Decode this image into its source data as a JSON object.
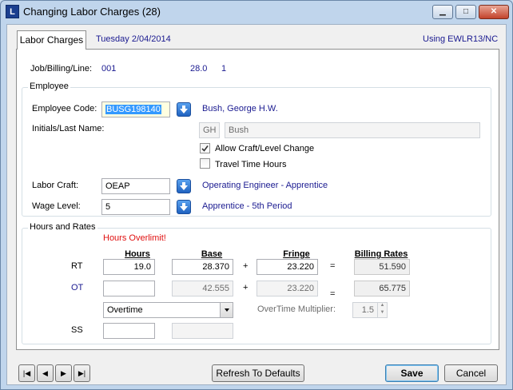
{
  "window": {
    "title": "Changing Labor Charges  (28)",
    "app_icon": "L",
    "minimize": "▁",
    "maximize": "□",
    "close": "✕"
  },
  "tab": {
    "label": "Labor Charges",
    "date": "Tuesday  2/04/2014",
    "using": "Using EWLR13/NC"
  },
  "job": {
    "label": "Job/Billing/Line:",
    "job": "001",
    "billing": "28.0",
    "line": "1"
  },
  "employee": {
    "group_label": "Employee",
    "code_label": "Employee Code:",
    "code_value": "BUSG198140",
    "name": "Bush, George H.W.",
    "initials_label": "Initials/Last Name:",
    "initials": "GH",
    "last_name": "Bush",
    "allow_craft_label": "Allow Craft/Level Change",
    "allow_craft_checked": true,
    "travel_label": "Travel Time Hours",
    "travel_checked": false,
    "craft_label": "Labor Craft:",
    "craft_value": "OEAP",
    "craft_desc": "Operating Engineer - Apprentice",
    "wage_label": "Wage Level:",
    "wage_value": "5",
    "wage_desc": "Apprentice - 5th Period"
  },
  "hours": {
    "group_label": "Hours and Rates",
    "warning": "Hours Overlimit!",
    "col_hours": "Hours",
    "col_base": "Base",
    "col_fringe": "Fringe",
    "col_billing": "Billing Rates",
    "plus": "+",
    "equals": "=",
    "rt_label": "RT",
    "rt_hours": "19.0",
    "rt_base": "28.370",
    "rt_fringe": "23.220",
    "rt_billing": "51.590",
    "ot_label": "OT",
    "ot_hours": "",
    "ot_base": "42.555",
    "ot_fringe": "23.220",
    "ot_billing": "65.775",
    "ot_type": "Overtime",
    "multiplier_label": "OverTime Multiplier:",
    "multiplier_value": "1.5",
    "ss_label": "SS",
    "ss_hours": "",
    "ss_base": ""
  },
  "footer": {
    "first": "|◀",
    "prev": "◀",
    "next": "▶",
    "last": "▶|",
    "refresh_label": "Refresh To Defaults",
    "save_label": "Save",
    "cancel_label": "Cancel"
  }
}
